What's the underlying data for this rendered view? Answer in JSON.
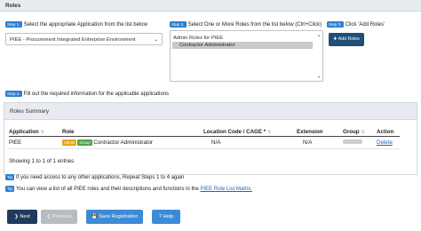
{
  "section": {
    "title": "Roles"
  },
  "step1": {
    "badge": "Step 1.",
    "text": "Select the appropriate Application from the list below",
    "selected": "PIEE - Procurement Integrated Enterprise Environment"
  },
  "step2": {
    "badge": "Step 2.",
    "text": "Select One or More Roles from the list below (Ctrl+Click)",
    "group": "Admin Roles for PIEE",
    "option": "Contractor Administrator"
  },
  "step3": {
    "badge": "Step 3.",
    "text": "Click 'Add Roles'",
    "button": "Add Roles"
  },
  "step4": {
    "badge": "Step 4.",
    "text": "Fill out the required information for the applicable applications"
  },
  "summary": {
    "title": "Roles Summary",
    "columns": [
      "Application",
      "Role",
      "Location Code / CAGE *",
      "Extension",
      "Group",
      "Action"
    ],
    "rows": [
      {
        "application": "PIEE",
        "badge_admin": "Admin",
        "badge_group": "Group",
        "role": "Contractor Administrator",
        "location": "N/A",
        "extension": "N/A",
        "action": "Delete"
      }
    ],
    "footer": "Showing 1 to 1 of 1 entries"
  },
  "tips": [
    {
      "badge": "Tip",
      "text": "If you need access to any other applications, Repeat Steps 1 to 4 again"
    },
    {
      "badge": "Tip",
      "text": "You can view a list of all PIEE roles and their descriptions and functions in the",
      "link": "PIEE Role List Matrix."
    }
  ],
  "buttons": {
    "next": "Next",
    "previous": "Previous",
    "save": "Save Registration",
    "help": "Help"
  }
}
